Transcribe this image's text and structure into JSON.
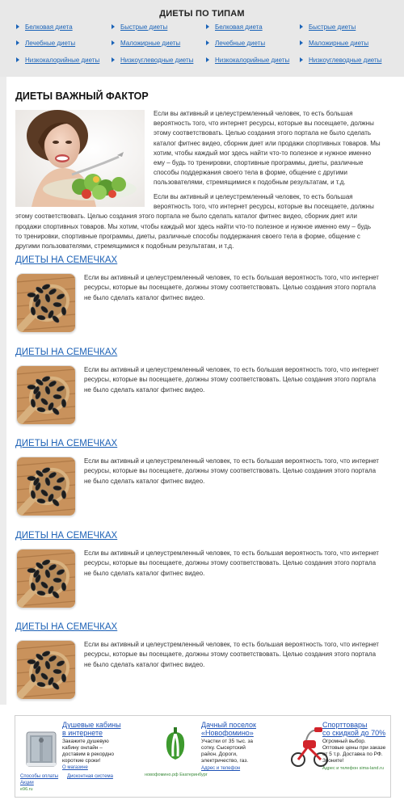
{
  "header": {
    "title": "ДИЕТЫ ПО ТИПАМ",
    "nav": [
      [
        "Белковая диета",
        "Быстрые диеты",
        "Белковая диета",
        "Быстрые диеты"
      ],
      [
        "Лечебные диеты",
        "Маложирные диеты",
        "Лечебные диеты",
        "Маложирные диеты"
      ],
      [
        "Низкокалорийные диеты",
        "Низкоуглеводные диеты",
        "Низкокалорийные диеты",
        "Низкоуглеводные диеты"
      ]
    ]
  },
  "main": {
    "title": "ДИЕТЫ ВАЖНЫЙ ФАКТОР",
    "para1_lines": [
      "Если вы активный и целеустремленный человек, то есть большая",
      "вероятность того, что интернет ресурсы, которые вы посещаете, должны",
      "этому соответствовать. Целью создания этого портала не было сделать",
      "каталог фитнес видео, сборник диет или продажи спортивных товаров. Мы",
      "хотим, чтобы каждый мог здесь найти что-то полезное и нужное именно",
      "ему – будь то тренировки, спортивные программы, диеты, различные",
      "способы поддержания своего тела в форме, общение с другими",
      "пользователями, стремящимися к подобным результатам, и т.д."
    ],
    "para2_lines": [
      "Если вы активный и целеустремленный человек, то есть большая",
      "вероятность того, что интернет ресурсы, которые вы посещаете, должны",
      "этому соответствовать. Целью создания этого портала не было сделать каталог фитнес видео, сборник диет или",
      "продажи спортивных товаров. Мы хотим, чтобы каждый мог здесь найти что-то полезное и нужное именно ему – будь",
      "то тренировки, спортивные программы, диеты, различные способы поддержания своего тела в форме, общение с",
      "другими пользователями, стремящимися к подобным результатам, и т.д."
    ],
    "articles": [
      {
        "title": "ДИЕТЫ НА СЕМЕЧКАХ",
        "lines": [
          "Если вы активный и целеустремленный человек, то есть большая вероятность того, что интернет",
          "ресурсы, которые вы посещаете, должны этому соответствовать. Целью создания этого портала",
          "не было сделать каталог фитнес видео."
        ]
      },
      {
        "title": "ДИЕТЫ НА СЕМЕЧКАХ",
        "lines": [
          "Если вы активный и целеустремленный человек, то есть большая вероятность того, что интернет",
          "ресурсы, которые вы посещаете, должны этому соответствовать. Целью создания этого портала",
          "не было сделать каталог фитнес видео."
        ]
      },
      {
        "title": "ДИЕТЫ НА СЕМЕЧКАХ",
        "lines": [
          "Если вы активный и целеустремленный человек, то есть большая вероятность того, что интернет",
          "ресурсы, которые вы посещаете, должны этому соответствовать. Целью создания этого портала",
          "не было сделать каталог фитнес видео."
        ]
      },
      {
        "title": "ДИЕТЫ НА СЕМЕЧКАХ",
        "lines": [
          "Если вы активный и целеустремленный человек, то есть большая вероятность того, что интернет",
          "ресурсы, которые вы посещаете, должны этому соответствовать. Целью создания этого портала",
          "не было сделать каталог фитнес видео."
        ]
      },
      {
        "title": "ДИЕТЫ НА СЕМЕЧКАХ",
        "lines": [
          "Если вы активный и целеустремленный человек, то есть большая вероятность того, что интернет",
          "ресурсы, которые вы посещаете, должны этому соответствовать. Целью создания этого портала",
          "не было сделать каталог фитнес видео."
        ]
      }
    ]
  },
  "ads": [
    {
      "title_lines": [
        "Душевые кабины",
        "в интернете"
      ],
      "text_lines": [
        "Закажите душевую",
        "кабину онлайн –",
        "доставим в рекордно",
        "короткие сроки!",
        "О магазине"
      ],
      "links": [
        "Способы оплаты",
        "Дисконтная система",
        "Акции"
      ],
      "foot": "e96.ru"
    },
    {
      "title_lines": [
        "Дачный поселок",
        "«Новофомино»"
      ],
      "text_lines": [
        "Участки от 35 тыс. за",
        "сотку. Сысертский",
        "район. Дороги,",
        "электричество, газ."
      ],
      "links": [
        "Адрес и телефон"
      ],
      "foot": "новофомино.рф  Екатеринбург"
    },
    {
      "title_lines": [
        "Спорттовары",
        "со скидкой до 70%"
      ],
      "text_lines": [
        "Огромный выбор.",
        "Оптовые цены при заказе",
        "от 5 т.р. Доставка по РФ.",
        "Звоните!"
      ],
      "links": [],
      "foot": "Адрес и телефон  sima-land.ru"
    }
  ]
}
